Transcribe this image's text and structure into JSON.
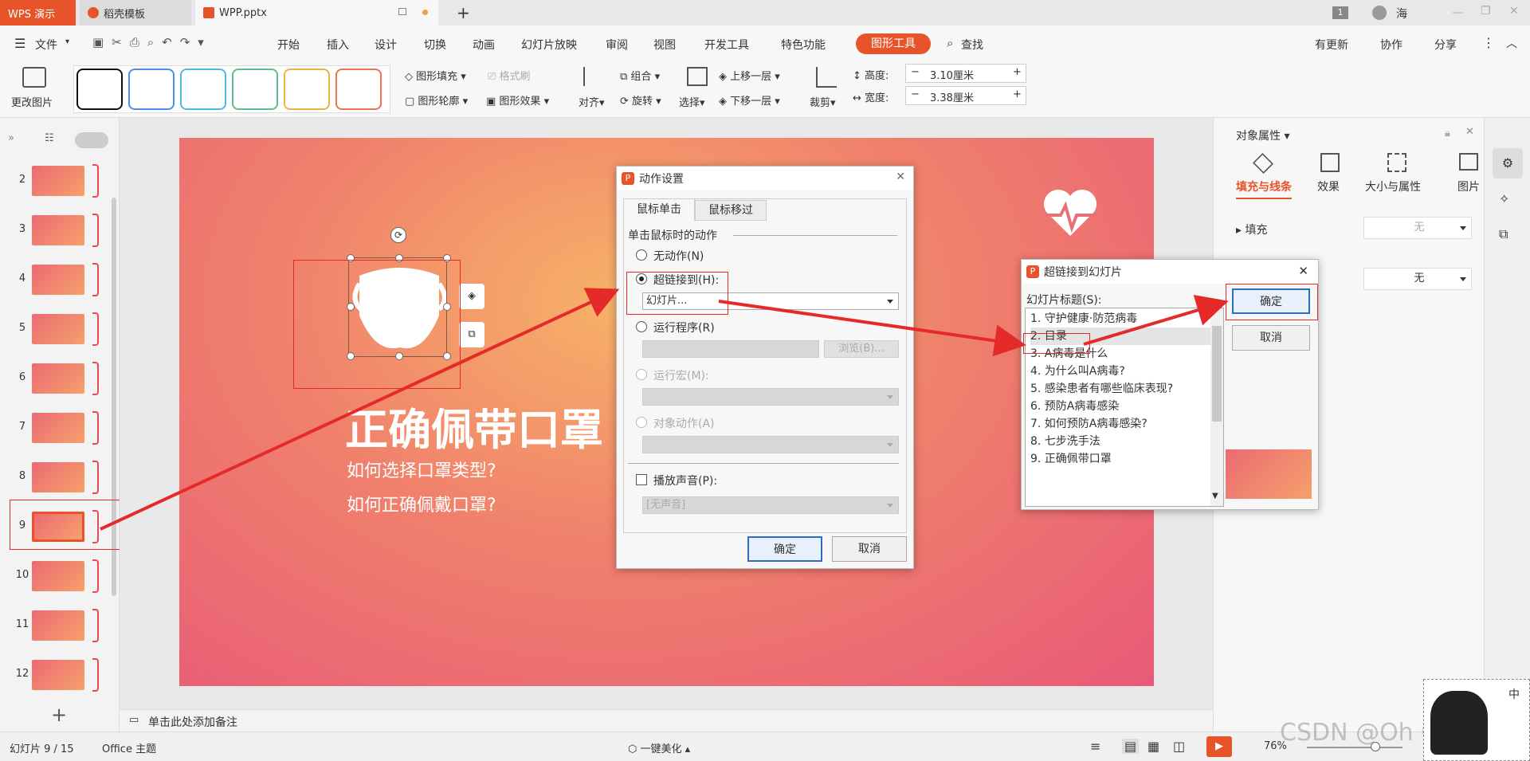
{
  "tabs": [
    {
      "label": "WPS 演示"
    },
    {
      "label": "稻壳模板"
    },
    {
      "label": "WPP.pptx"
    }
  ],
  "title_user": "海",
  "title_badge": "1",
  "menu": {
    "file": "文件",
    "items": [
      "开始",
      "插入",
      "设计",
      "切换",
      "动画",
      "幻灯片放映",
      "审阅",
      "视图",
      "开发工具",
      "特色功能"
    ],
    "active": "图形工具",
    "search": "查找",
    "update": "有更新",
    "collab": "协作",
    "share": "分享"
  },
  "ribbon": {
    "change_picture": "更改图片",
    "shape_fill": "图形填充",
    "format_painter": "格式刷",
    "shape_outline": "图形轮廓",
    "shape_effect": "图形效果",
    "align": "对齐",
    "group": "组合",
    "rotate": "旋转",
    "select": "选择",
    "bring_forward": "上移一层",
    "send_backward": "下移一层",
    "crop": "裁剪",
    "height_label": "高度:",
    "height_value": "3.10厘米",
    "width_label": "宽度:",
    "width_value": "3.38厘米"
  },
  "thumbnails": [
    "2",
    "3",
    "4",
    "5",
    "6",
    "7",
    "8",
    "9",
    "10",
    "11",
    "12"
  ],
  "slide": {
    "title": "正确佩带口罩",
    "line1": "如何选择口罩类型?",
    "line2": "如何正确佩戴口罩?"
  },
  "action_dialog": {
    "title": "动作设置",
    "tab_click": "鼠标单击",
    "tab_hover": "鼠标移过",
    "group_label": "单击鼠标时的动作",
    "none": "无动作(N)",
    "hyperlink": "超链接到(H):",
    "hyperlink_value": "幻灯片...",
    "run_program": "运行程序(R)",
    "browse": "浏览(B)...",
    "run_macro": "运行宏(M):",
    "object_action": "对象动作(A)",
    "play_sound": "播放声音(P):",
    "sound_value": "[无声音]",
    "ok": "确定",
    "cancel": "取消"
  },
  "hyperlink_dialog": {
    "title": "超链接到幻灯片",
    "list_label": "幻灯片标题(S):",
    "items": [
      "1. 守护健康·防范病毒",
      "2. 目录",
      "3. A病毒是什么",
      "4. 为什么叫A病毒?",
      "5. 感染患者有哪些临床表现?",
      "6. 预防A病毒感染",
      "7. 如何预防A病毒感染?",
      "8. 七步洗手法",
      "9. 正确佩带口罩"
    ],
    "selected_index": 1,
    "ok": "确定",
    "cancel": "取消"
  },
  "right_panel": {
    "title": "对象属性",
    "tabs": [
      "填充与线条",
      "效果",
      "大小与属性",
      "图片"
    ],
    "fill_label": "填充",
    "fill_value": "无",
    "line_value": "无"
  },
  "notes_placeholder": "单击此处添加备注",
  "status": {
    "slide_info": "幻灯片 9 / 15",
    "theme": "Office 主题",
    "beautify": "一键美化",
    "zoom": "76%"
  },
  "watermark": "CSDN @Oh Correct",
  "ime": "中",
  "colors": {
    "accent": "#e8542a",
    "red": "#e52a2a",
    "primary_button": "#2d6cc0"
  }
}
